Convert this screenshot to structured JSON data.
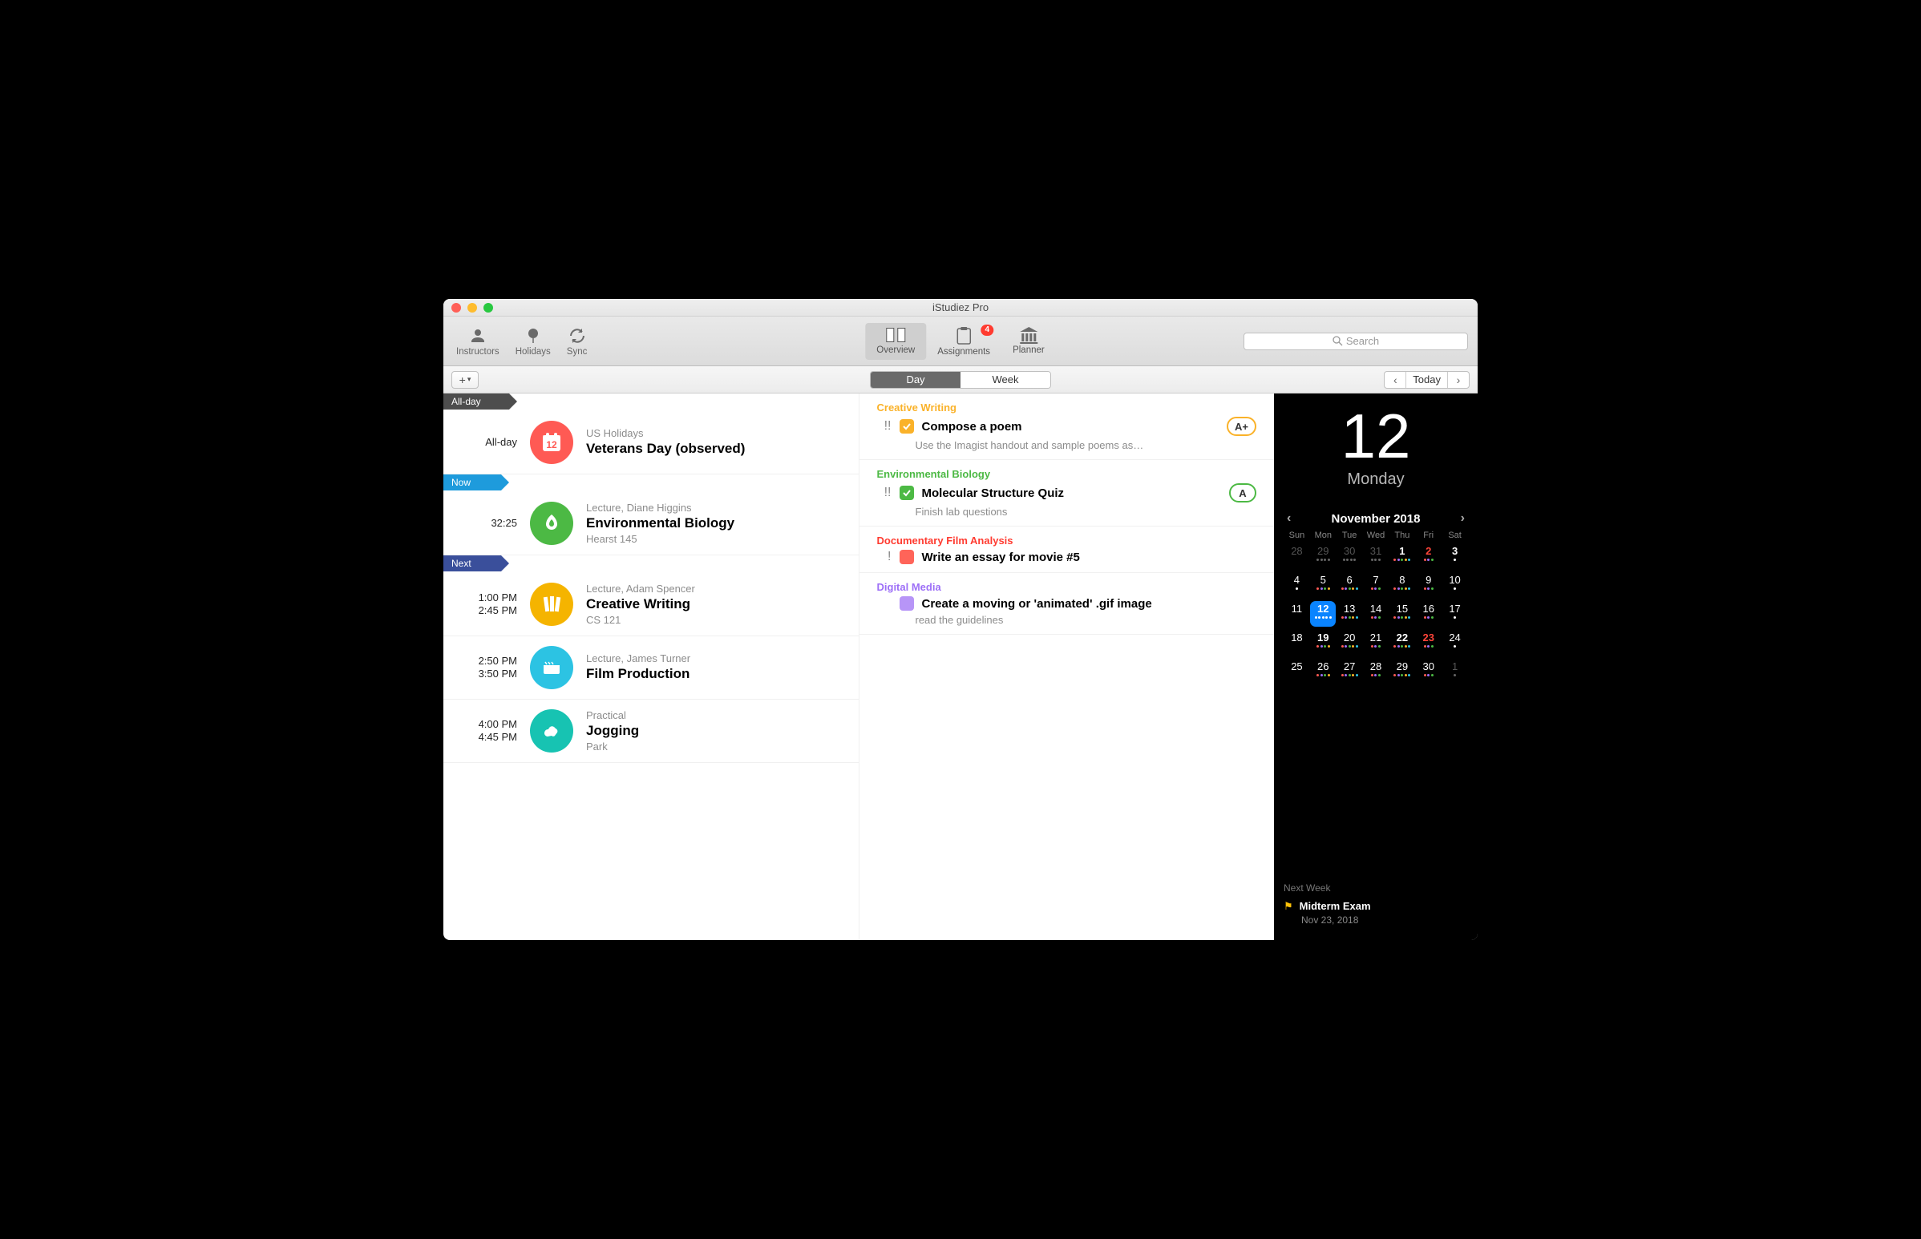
{
  "window": {
    "title": "iStudiez Pro"
  },
  "toolbar": {
    "left": [
      {
        "label": "Instructors"
      },
      {
        "label": "Holidays"
      },
      {
        "label": "Sync"
      }
    ],
    "tabs": {
      "overview": "Overview",
      "assignments": "Assignments",
      "planner": "Planner",
      "badge": "4"
    },
    "search_placeholder": "Search"
  },
  "subtoolbar": {
    "segmented": {
      "day": "Day",
      "week": "Week"
    },
    "today": "Today"
  },
  "ribbons": {
    "allday": "All-day",
    "now": "Now",
    "next": "Next"
  },
  "events": [
    {
      "time_label": "All-day",
      "icon_bg": "#ff5a54",
      "subtitle": "US Holidays",
      "title": "Veterans Day (observed)",
      "location": "",
      "icon_day": "12"
    },
    {
      "time_label": "32:25",
      "icon_bg": "#4cb944",
      "subtitle": "Lecture, Diane Higgins",
      "title": "Environmental Biology",
      "location": "Hearst 145"
    },
    {
      "time_label": "1:00 PM\n2:45 PM",
      "icon_bg": "#f5b400",
      "subtitle": "Lecture, Adam Spencer",
      "title": "Creative Writing",
      "location": "CS 121"
    },
    {
      "time_label": "2:50 PM\n3:50 PM",
      "icon_bg": "#2cc3e3",
      "subtitle": "Lecture, James Turner",
      "title": "Film Production",
      "location": ""
    },
    {
      "time_label": "4:00 PM\n4:45 PM",
      "icon_bg": "#17c3b2",
      "subtitle": "Practical",
      "title": "Jogging",
      "location": "Park"
    }
  ],
  "assignments": [
    {
      "course": "Creative Writing",
      "course_color": "#fab229",
      "priority": "!!",
      "done": true,
      "check_color": "#fab229",
      "title": "Compose a poem",
      "note": "Use the Imagist handout and sample poems as…",
      "grade": "A+",
      "grade_color": "#fab229"
    },
    {
      "course": "Environmental Biology",
      "course_color": "#4cb944",
      "priority": "!!",
      "done": true,
      "check_color": "#4cb944",
      "title": "Molecular Structure Quiz",
      "note": "Finish lab questions",
      "grade": "A",
      "grade_color": "#4cb944"
    },
    {
      "course": "Documentary Film Analysis",
      "course_color": "#ff3b30",
      "priority": "!",
      "done": false,
      "check_color": "#ff6459",
      "title": "Write an essay for movie #5",
      "note": "",
      "grade": "",
      "grade_color": ""
    },
    {
      "course": "Digital Media",
      "course_color": "#9d6ff7",
      "priority": "",
      "done": false,
      "check_color": "#b795f7",
      "title": "Create a moving or 'animated' .gif image",
      "note": "read the guidelines",
      "grade": "",
      "grade_color": ""
    }
  ],
  "sidebar": {
    "big_date": "12",
    "big_day": "Monday",
    "month_label": "November 2018",
    "dow": [
      "Sun",
      "Mon",
      "Tue",
      "Wed",
      "Thu",
      "Fri",
      "Sat"
    ],
    "days": [
      {
        "n": "28",
        "dim": true,
        "dots": []
      },
      {
        "n": "29",
        "dim": true,
        "dots": [
          "#666",
          "#666",
          "#666",
          "#666"
        ]
      },
      {
        "n": "30",
        "dim": true,
        "dots": [
          "#666",
          "#666",
          "#666",
          "#666"
        ]
      },
      {
        "n": "31",
        "dim": true,
        "dots": [
          "#666",
          "#666",
          "#666"
        ]
      },
      {
        "n": "1",
        "bold": true,
        "dots": [
          "#ff5a54",
          "#9d6ff7",
          "#4cb944",
          "#fab229",
          "#2cc3e3"
        ]
      },
      {
        "n": "2",
        "red": true,
        "dots": [
          "#ff5a54",
          "#9d6ff7",
          "#4cb944"
        ]
      },
      {
        "n": "3",
        "bold": true,
        "dots": [
          "#fff"
        ]
      },
      {
        "n": "4",
        "dots": [
          "#fff"
        ]
      },
      {
        "n": "5",
        "dots": [
          "#ff5a54",
          "#9d6ff7",
          "#4cb944",
          "#fab229"
        ]
      },
      {
        "n": "6",
        "dots": [
          "#ff5a54",
          "#9d6ff7",
          "#4cb944",
          "#fab229",
          "#2cc3e3"
        ]
      },
      {
        "n": "7",
        "dots": [
          "#ff5a54",
          "#9d6ff7",
          "#4cb944"
        ]
      },
      {
        "n": "8",
        "dots": [
          "#ff5a54",
          "#9d6ff7",
          "#4cb944",
          "#fab229",
          "#2cc3e3"
        ]
      },
      {
        "n": "9",
        "dots": [
          "#ff5a54",
          "#9d6ff7",
          "#4cb944"
        ]
      },
      {
        "n": "10",
        "dots": [
          "#fff"
        ]
      },
      {
        "n": "11",
        "dots": []
      },
      {
        "n": "12",
        "today": true,
        "dots": [
          "#fff",
          "#fff",
          "#fff",
          "#fff",
          "#fff"
        ]
      },
      {
        "n": "13",
        "dots": [
          "#ff5a54",
          "#9d6ff7",
          "#4cb944",
          "#fab229",
          "#2cc3e3"
        ]
      },
      {
        "n": "14",
        "dots": [
          "#ff5a54",
          "#9d6ff7",
          "#4cb944"
        ]
      },
      {
        "n": "15",
        "dots": [
          "#ff5a54",
          "#9d6ff7",
          "#4cb944",
          "#fab229",
          "#2cc3e3"
        ]
      },
      {
        "n": "16",
        "dots": [
          "#ff5a54",
          "#9d6ff7",
          "#4cb944"
        ]
      },
      {
        "n": "17",
        "dots": [
          "#fff"
        ]
      },
      {
        "n": "18",
        "dots": []
      },
      {
        "n": "19",
        "bold": true,
        "dots": [
          "#ff5a54",
          "#9d6ff7",
          "#4cb944",
          "#fab229"
        ]
      },
      {
        "n": "20",
        "dots": [
          "#ff5a54",
          "#9d6ff7",
          "#4cb944",
          "#fab229",
          "#2cc3e3"
        ]
      },
      {
        "n": "21",
        "dots": [
          "#ff5a54",
          "#9d6ff7",
          "#4cb944"
        ]
      },
      {
        "n": "22",
        "bold": true,
        "dots": [
          "#ff5a54",
          "#9d6ff7",
          "#4cb944",
          "#fab229",
          "#2cc3e3"
        ]
      },
      {
        "n": "23",
        "red": true,
        "dots": [
          "#ff5a54",
          "#9d6ff7",
          "#4cb944"
        ]
      },
      {
        "n": "24",
        "dots": [
          "#fff"
        ]
      },
      {
        "n": "25",
        "dots": []
      },
      {
        "n": "26",
        "dots": [
          "#ff5a54",
          "#9d6ff7",
          "#4cb944",
          "#fab229"
        ]
      },
      {
        "n": "27",
        "dots": [
          "#ff5a54",
          "#9d6ff7",
          "#4cb944",
          "#fab229",
          "#2cc3e3"
        ]
      },
      {
        "n": "28",
        "dots": [
          "#ff5a54",
          "#9d6ff7",
          "#4cb944"
        ]
      },
      {
        "n": "29",
        "dots": [
          "#ff5a54",
          "#9d6ff7",
          "#4cb944",
          "#fab229",
          "#2cc3e3"
        ]
      },
      {
        "n": "30",
        "dots": [
          "#ff5a54",
          "#9d6ff7",
          "#4cb944"
        ]
      },
      {
        "n": "1",
        "dim": true,
        "dots": [
          "#666"
        ]
      }
    ],
    "next_week_label": "Next Week",
    "next_week_item": {
      "title": "Midterm Exam",
      "date": "Nov 23, 2018"
    }
  }
}
